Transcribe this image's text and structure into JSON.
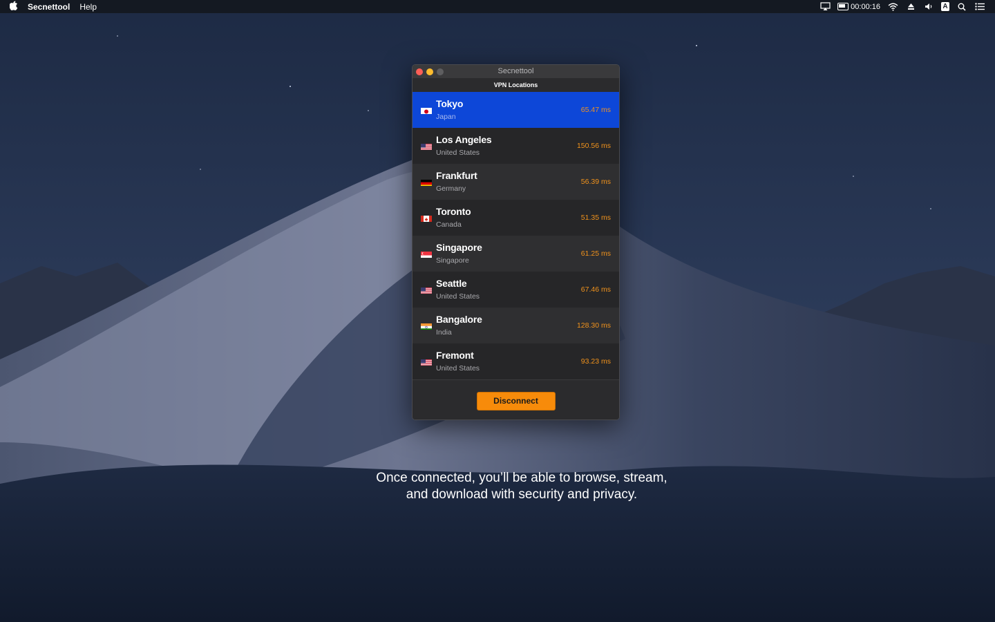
{
  "menubar": {
    "apple_icon": "apple-icon",
    "app_name": "Secnettool",
    "help": "Help",
    "timer": "00:00:16",
    "ime_letter": "A"
  },
  "window": {
    "title": "Secnettool",
    "panel_title": "VPN Locations",
    "selected_index": 0,
    "locations": [
      {
        "city": "Tokyo",
        "country": "Japan",
        "ping": "65.47 ms",
        "flag": "japan"
      },
      {
        "city": "Los Angeles",
        "country": "United States",
        "ping": "150.56 ms",
        "flag": "usa"
      },
      {
        "city": "Frankfurt",
        "country": "Germany",
        "ping": "56.39 ms",
        "flag": "germany"
      },
      {
        "city": "Toronto",
        "country": "Canada",
        "ping": "51.35 ms",
        "flag": "canada"
      },
      {
        "city": "Singapore",
        "country": "Singapore",
        "ping": "61.25 ms",
        "flag": "singapore"
      },
      {
        "city": "Seattle",
        "country": "United States",
        "ping": "67.46 ms",
        "flag": "usa"
      },
      {
        "city": "Bangalore",
        "country": "India",
        "ping": "128.30 ms",
        "flag": "india"
      },
      {
        "city": "Fremont",
        "country": "United States",
        "ping": "93.23 ms",
        "flag": "usa"
      }
    ],
    "disconnect_label": "Disconnect"
  },
  "caption": {
    "line1": "Once connected, you’ll be able to browse, stream,",
    "line2": "and download with security and privacy."
  },
  "colors": {
    "selection": "#0d47d8",
    "ping": "#f2931c",
    "button": "#f78b0a"
  }
}
